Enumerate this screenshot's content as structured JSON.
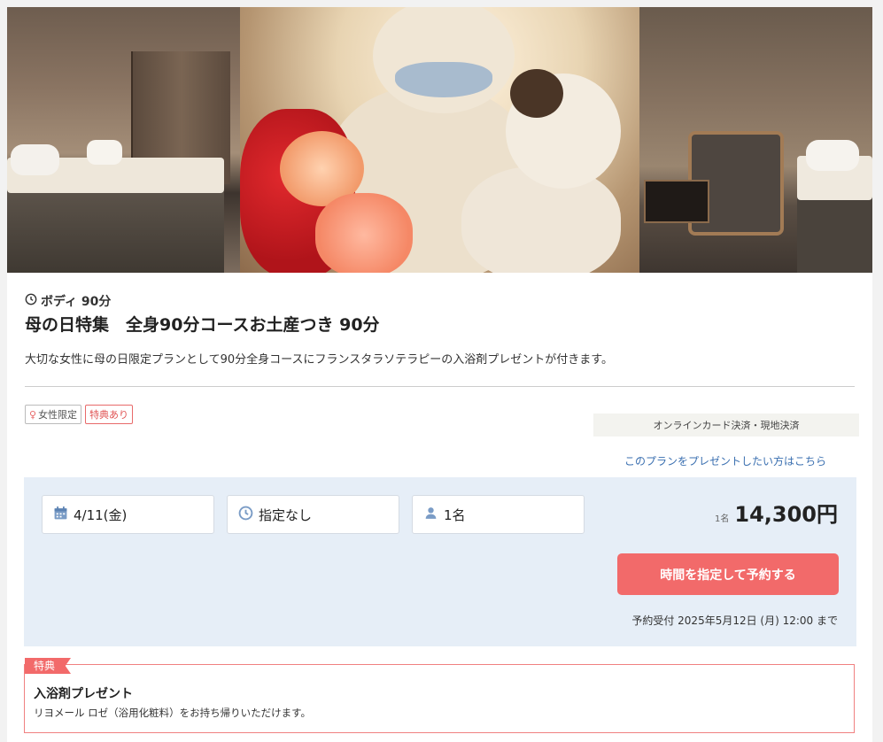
{
  "plan": {
    "category": "ボディ 90分",
    "title": "母の日特集　全身90分コースお土産つき 90分",
    "description": "大切な女性に母の日限定プランとして90分全身コースにフランスタラソテラピーの入浴剤プレゼントが付きます。"
  },
  "tags": [
    "女性限定",
    "特典あり"
  ],
  "payment": "オンラインカード決済・現地決済",
  "gift_link": "このプランをプレゼントしたい方はこちら",
  "booking": {
    "date": "4/11(金)",
    "time": "指定なし",
    "people": "1名",
    "price_unit": "1名",
    "price": "14,300円",
    "reserve_button": "時間を指定して予約する",
    "deadline": "予約受付 2025年5月12日 (月) 12:00 まで"
  },
  "benefit": {
    "badge": "特典",
    "title": "入浴剤プレゼント",
    "description": "リヨメール ロゼ（浴用化粧料）をお持ち帰りいただけます。"
  },
  "colors": {
    "accent": "#f26a6a",
    "panel": "#e6eef7",
    "link": "#3a6fb0"
  },
  "icons": [
    "clock-icon",
    "calendar-icon",
    "person-icon",
    "woman-icon"
  ]
}
